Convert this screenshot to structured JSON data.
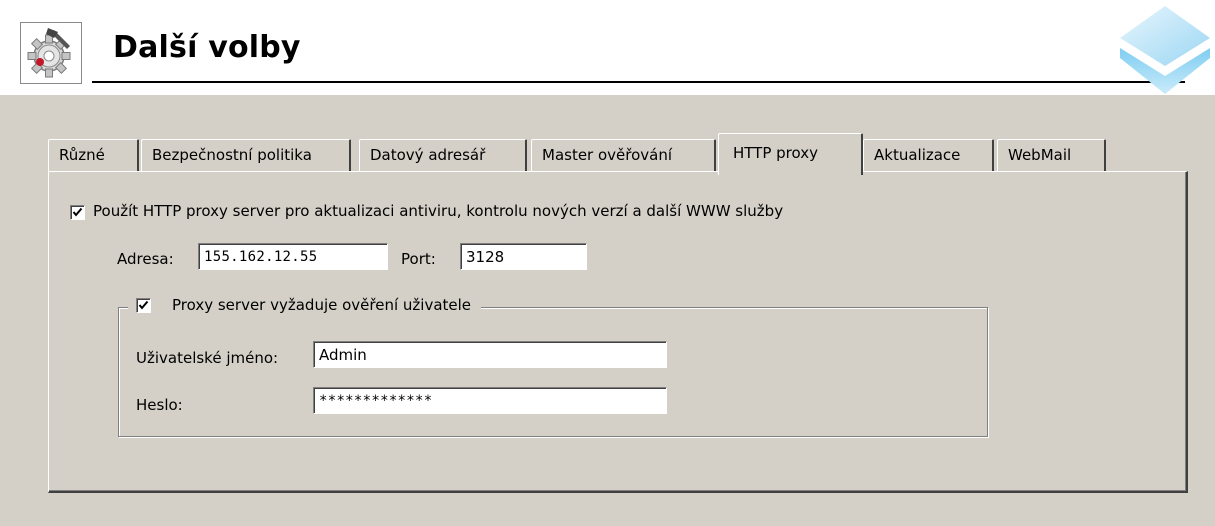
{
  "header": {
    "title": "Další volby",
    "icon": "settings-gear-icon",
    "logo": "blue-diamond-logo"
  },
  "tabs": [
    {
      "label": "Různé",
      "active": false
    },
    {
      "label": "Bezpečnostní politika",
      "active": false
    },
    {
      "label": "Datový adresář",
      "active": false
    },
    {
      "label": "Master ověřování",
      "active": false
    },
    {
      "label": "HTTP proxy",
      "active": true
    },
    {
      "label": "Aktualizace",
      "active": false
    },
    {
      "label": "WebMail",
      "active": false
    }
  ],
  "proxy": {
    "use_proxy_label": "Použít HTTP proxy server pro aktualizaci antiviru, kontrolu nových verzí a další WWW služby",
    "use_proxy_checked": true,
    "address_label": "Adresa:",
    "address_value": "155.162.12.55",
    "port_label": "Port:",
    "port_value": "3128",
    "auth": {
      "label": "Proxy server vyžaduje ověření uživatele",
      "checked": true,
      "username_label": "Uživatelské jméno:",
      "username_value": "Admin",
      "password_label": "Heslo:",
      "password_value": "*************"
    }
  },
  "colors": {
    "dialog_bg": "#d4d0c8",
    "header_bg": "#ffffff",
    "logo_blue": "#6cc3ee"
  }
}
